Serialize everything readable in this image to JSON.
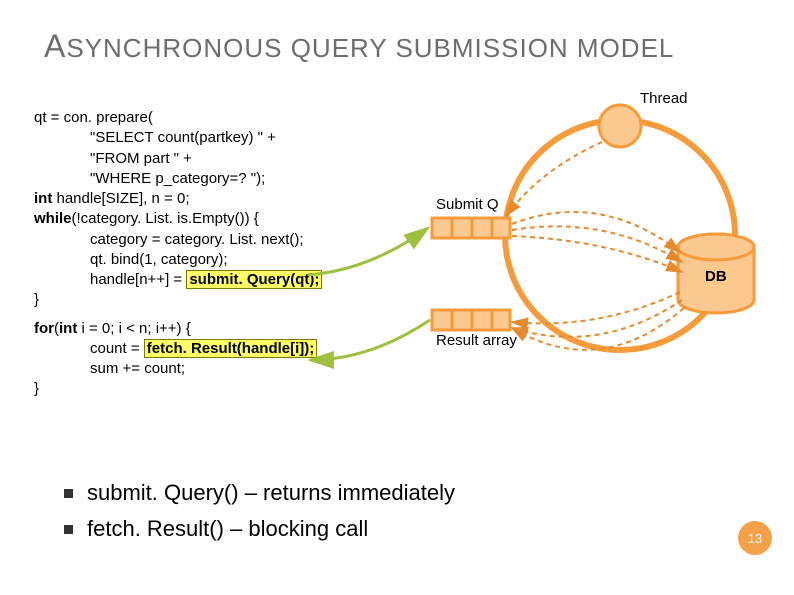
{
  "title": "SYNCHRONOUS QUERY SUBMISSION MODEL",
  "titlePrefix": "A",
  "code": {
    "l1a": "qt = con. prepare(",
    "l2": "\"SELECT count(partkey) \" +",
    "l3": "\"FROM part \" +",
    "l4": "\"WHERE p_category=? \");",
    "l5a": "int",
    "l5b": " handle[SIZE], n = 0;",
    "l6a": "while",
    "l6b": "(!category. List. is.Empty()) {",
    "l7": "category = category. List. next();",
    "l8": "qt. bind(1, category);",
    "l9a": "handle[n++] = ",
    "l9b": "submit. Query(qt);",
    "l10": "}",
    "l11a": "for",
    "l11b": "(",
    "l11c": "int",
    "l11d": " i = 0; i < n; i++) {",
    "l12a": "count = ",
    "l12b": "fetch. Result(handle[i]);",
    "l13": "sum += count;",
    "l14": "}"
  },
  "labels": {
    "thread": "Thread",
    "submit": "Submit Q",
    "result": "Result array",
    "db": "DB"
  },
  "bullets": {
    "b1": "submit. Query() – returns immediately",
    "b2": "fetch. Result() – blocking call"
  },
  "page": "13",
  "colors": {
    "orange": "#f59b3a",
    "orangeLight": "#fbc88f",
    "dash": "#e68a2e",
    "green": "#9fbf3f"
  }
}
